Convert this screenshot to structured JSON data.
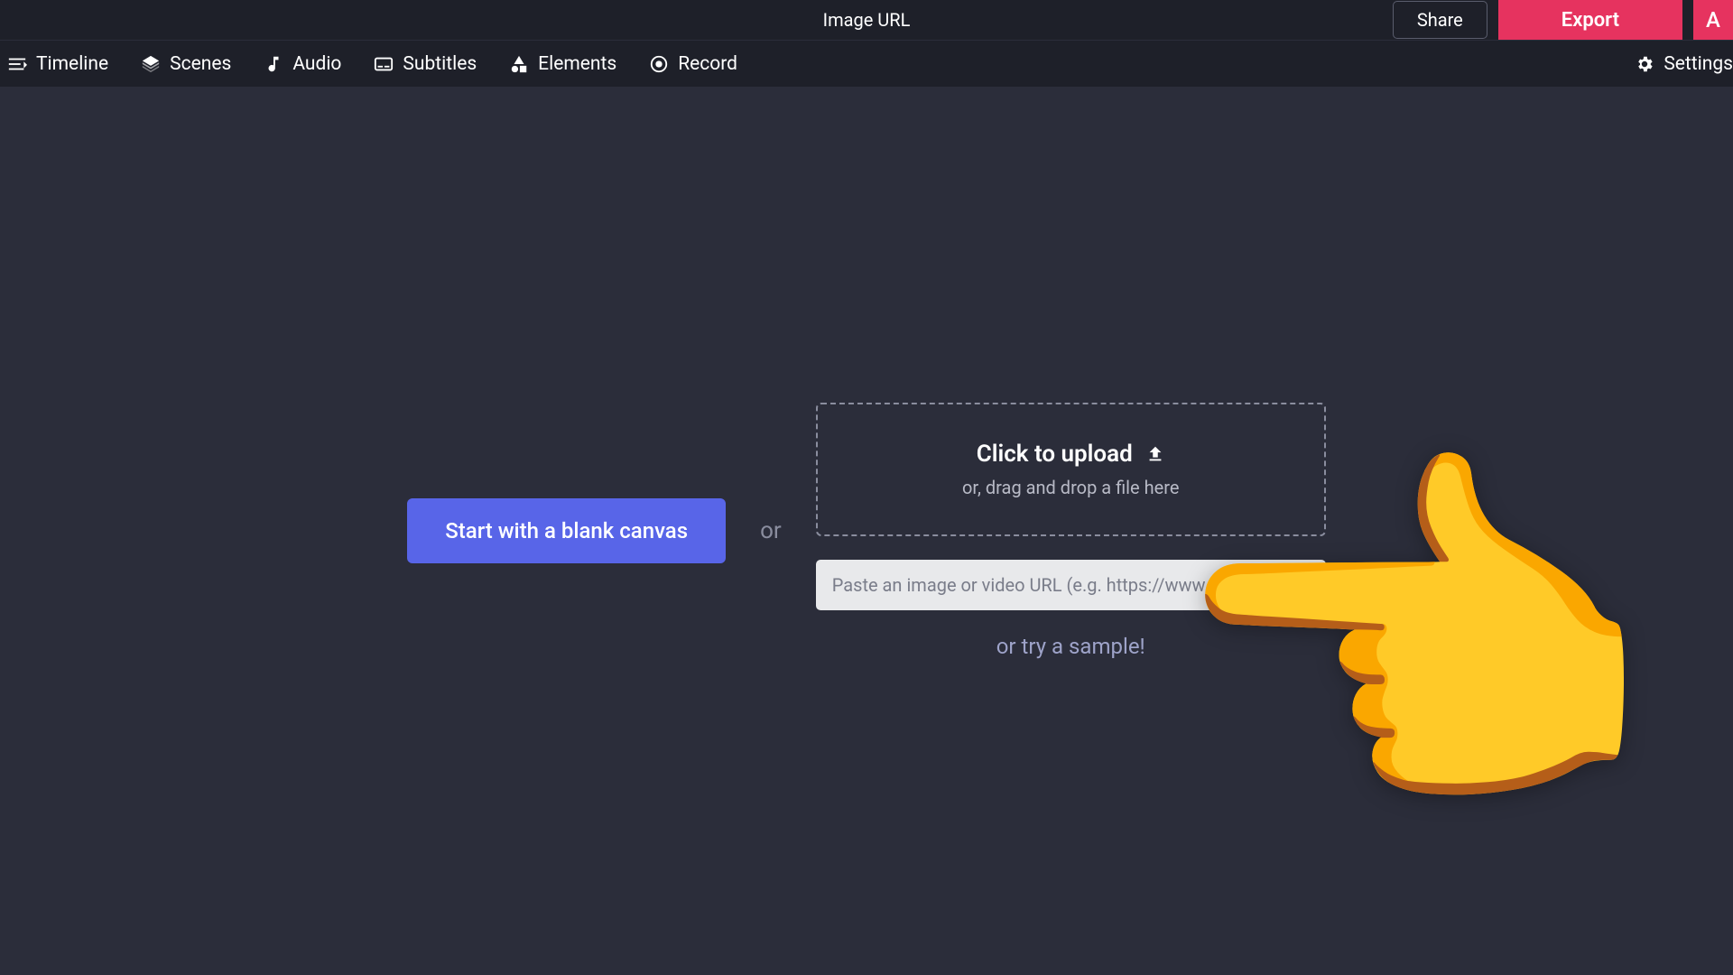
{
  "header": {
    "title": "Image URL",
    "share_label": "Share",
    "export_label": "Export",
    "avatar_letter": "A"
  },
  "toolbar": {
    "items": [
      {
        "label": "Timeline",
        "icon": "timeline-icon"
      },
      {
        "label": "Scenes",
        "icon": "layers-icon"
      },
      {
        "label": "Audio",
        "icon": "music-note-icon"
      },
      {
        "label": "Subtitles",
        "icon": "subtitles-icon"
      },
      {
        "label": "Elements",
        "icon": "shapes-icon"
      },
      {
        "label": "Record",
        "icon": "record-icon"
      }
    ],
    "settings_label": "Settings"
  },
  "canvas": {
    "blank_label": "Start with a blank canvas",
    "or_label": "or",
    "drop_title": "Click to upload",
    "drop_sub": "or, drag and drop a file here",
    "url_placeholder": "Paste an image or video URL (e.g. https://www.youtube.com/",
    "sample_label": "or try a sample!"
  }
}
